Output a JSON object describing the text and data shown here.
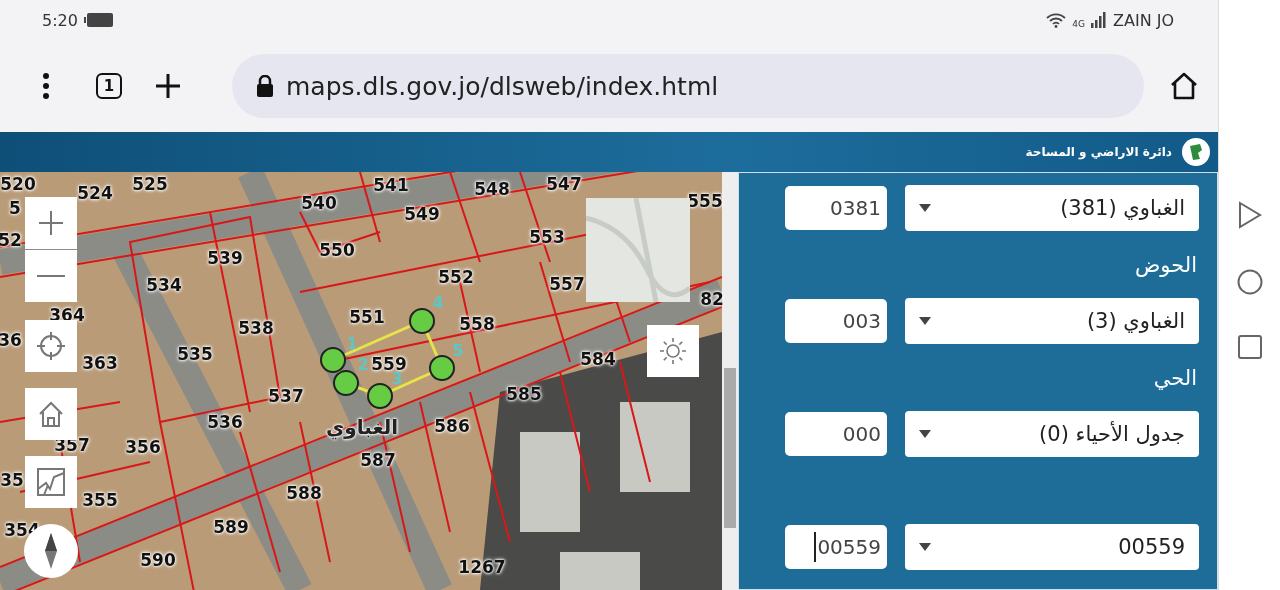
{
  "status_bar": {
    "time": "5:20",
    "network": "4G",
    "carrier": "ZAIN JO"
  },
  "browser": {
    "tab_count": "1",
    "url": "maps.dls.gov.jo/dlsweb/index.html"
  },
  "site_header": {
    "title": "دائرة الاراضي و المساحة"
  },
  "map": {
    "parcels": [
      {
        "text": "520"
      },
      {
        "text": "524"
      },
      {
        "text": "525"
      },
      {
        "text": "541"
      },
      {
        "text": "548"
      },
      {
        "text": "547"
      },
      {
        "text": "5"
      },
      {
        "text": "540"
      },
      {
        "text": "549"
      },
      {
        "text": "555"
      },
      {
        "text": "52"
      },
      {
        "text": "539"
      },
      {
        "text": "550"
      },
      {
        "text": "553"
      },
      {
        "text": "534"
      },
      {
        "text": "552"
      },
      {
        "text": "557"
      },
      {
        "text": "82"
      },
      {
        "text": "36"
      },
      {
        "text": "364"
      },
      {
        "text": "538"
      },
      {
        "text": "551"
      },
      {
        "text": "558"
      },
      {
        "text": "363"
      },
      {
        "text": "535"
      },
      {
        "text": "559"
      },
      {
        "text": "584"
      },
      {
        "text": "537"
      },
      {
        "text": "585"
      },
      {
        "text": "536"
      },
      {
        "text": "586"
      },
      {
        "text": "357"
      },
      {
        "text": "356"
      },
      {
        "text": "587"
      },
      {
        "text": "35"
      },
      {
        "text": "355"
      },
      {
        "text": "588"
      },
      {
        "text": "354"
      },
      {
        "text": "589"
      },
      {
        "text": "590"
      },
      {
        "text": "1267"
      }
    ],
    "area_label": "الغباوي",
    "points": [
      {
        "label": "1"
      },
      {
        "label": "2"
      },
      {
        "label": "3"
      },
      {
        "label": "4"
      },
      {
        "label": "5"
      }
    ]
  },
  "panel": {
    "fields": [
      {
        "code": "0381",
        "selection": "الغباوي (381)",
        "focused": false
      },
      {
        "label": "الحوض",
        "code": "003",
        "selection": "الغباوي (3)",
        "focused": false
      },
      {
        "label": "الحي",
        "code": "000",
        "selection": "جدول الأحياء (0)",
        "focused": false
      },
      {
        "code": "00559",
        "selection": "00559",
        "focused": true
      }
    ]
  }
}
